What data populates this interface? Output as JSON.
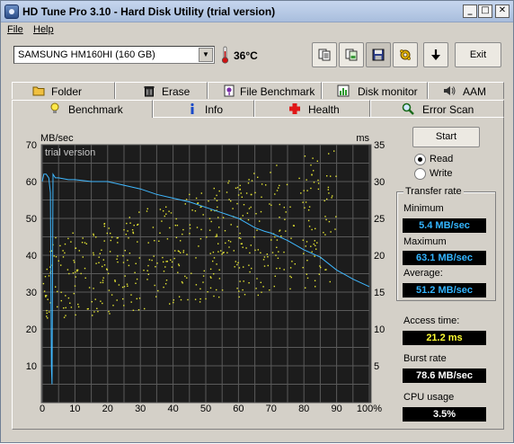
{
  "window": {
    "title": "HD Tune Pro 3.10 - Hard Disk Utility (trial version)",
    "controls": [
      "_",
      "□",
      "✕"
    ]
  },
  "menu": {
    "file": "File",
    "help": "Help"
  },
  "toolbar": {
    "drive": "SAMSUNG HM160HI (160 GB)",
    "temperature": "36°C",
    "exit_label": "Exit"
  },
  "tabs": {
    "row1": [
      "Folder Usage",
      "Erase",
      "File Benchmark",
      "Disk monitor",
      "AAM"
    ],
    "row2": [
      "Benchmark",
      "Info",
      "Health",
      "Error Scan"
    ],
    "active": "Benchmark"
  },
  "controls": {
    "start_label": "Start",
    "read_label": "Read",
    "write_label": "Write",
    "mode_selected": "Read"
  },
  "stats": {
    "transfer_rate_title": "Transfer rate",
    "minimum_label": "Minimum",
    "minimum_value": "5.4 MB/sec",
    "maximum_label": "Maximum",
    "maximum_value": "63.1 MB/sec",
    "average_label": "Average:",
    "average_value": "51.2 MB/sec",
    "access_label": "Access time:",
    "access_value": "21.2 ms",
    "burst_label": "Burst rate",
    "burst_value": "78.6 MB/sec",
    "cpu_label": "CPU usage",
    "cpu_value": "3.5%"
  },
  "colors": {
    "transfer_line": "#3fb8ff",
    "access_dots": "#e6e633",
    "chart_bg": "#1c1c1c",
    "grid": "#5a5a5a"
  },
  "chart_data": {
    "type": "line",
    "watermark": "trial version",
    "ylabel_left": "MB/sec",
    "ylabel_right": "ms",
    "ylim_left": [
      0,
      70
    ],
    "ylim_right": [
      0,
      35
    ],
    "xlim": [
      0,
      100
    ],
    "x_ticks": [
      "0",
      "10",
      "20",
      "30",
      "40",
      "50",
      "60",
      "70",
      "80",
      "90",
      "100%"
    ],
    "y_ticks_left": [
      "10",
      "20",
      "30",
      "40",
      "50",
      "60",
      "70"
    ],
    "y_ticks_right": [
      "5",
      "10",
      "15",
      "20",
      "25",
      "30",
      "35"
    ],
    "grid": true,
    "series": [
      {
        "axis": "left",
        "x": [
          0.0,
          0.5,
          1.2,
          2.0,
          2.5,
          2.8,
          3.0,
          3.3,
          4.0,
          5,
          8,
          10,
          15,
          20,
          25,
          30,
          35,
          40,
          45,
          50,
          55,
          60,
          62,
          65,
          68,
          70,
          75,
          80,
          85,
          90,
          95,
          100
        ],
        "y": [
          60,
          62,
          62,
          61,
          57,
          10,
          5,
          62,
          61,
          61,
          60.5,
          60.5,
          60,
          60,
          59,
          58,
          56.5,
          55.5,
          54.5,
          53,
          51.5,
          50,
          49,
          47.5,
          46.5,
          46,
          44,
          41.5,
          39.5,
          36,
          33.5,
          31.5
        ]
      },
      {
        "axis": "right",
        "type": "scatter",
        "x_range": [
          0,
          90
        ],
        "y_min_trend": [
          11,
          16
        ],
        "y_max_trend": [
          22,
          35
        ]
      }
    ]
  }
}
